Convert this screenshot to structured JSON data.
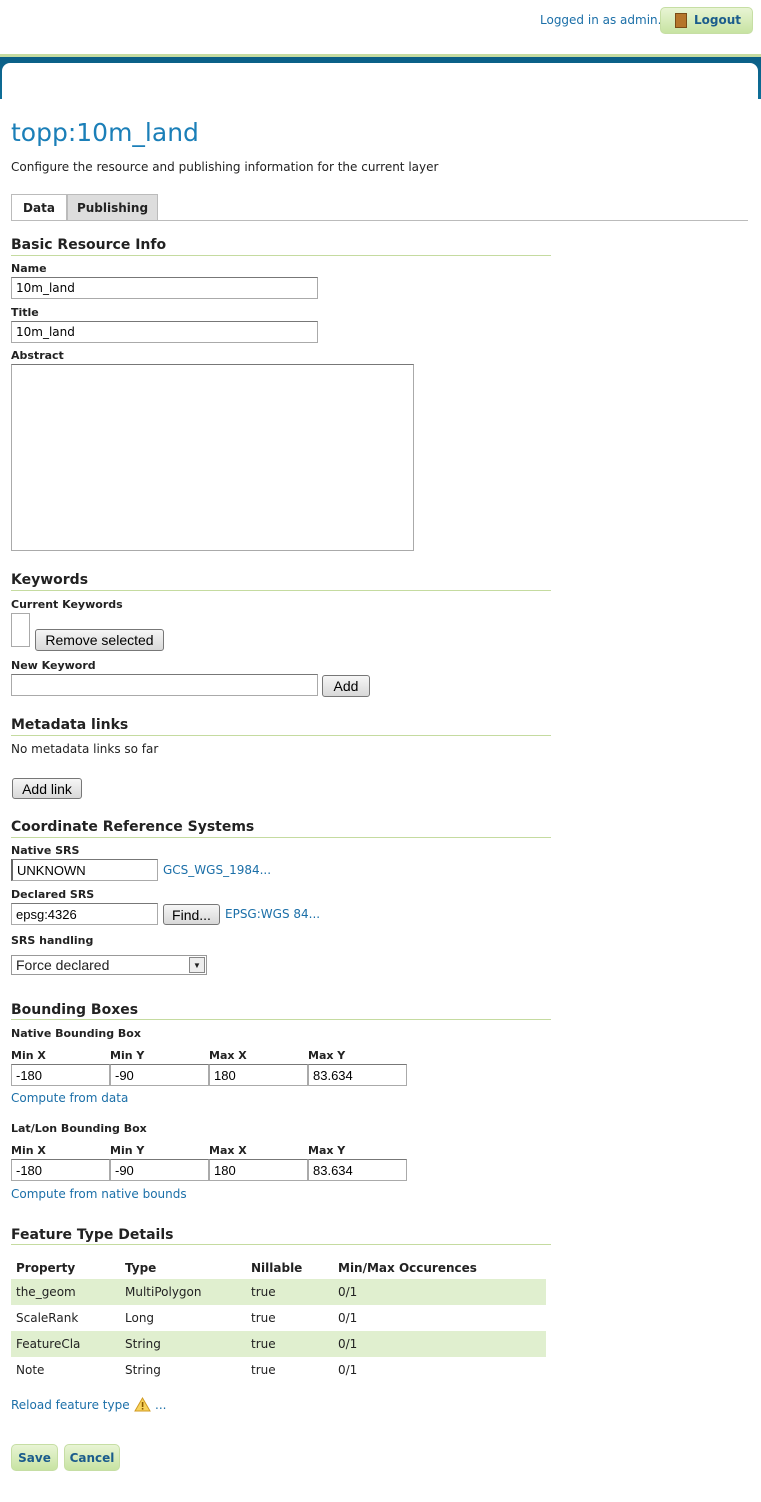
{
  "header": {
    "logged_in": "Logged in as admin.",
    "logout": "Logout"
  },
  "page": {
    "title": "topp:10m_land",
    "subtitle": "Configure the resource and publishing information for the current layer"
  },
  "tabs": [
    {
      "label": "Data",
      "active": true
    },
    {
      "label": "Publishing",
      "active": false
    }
  ],
  "basic": {
    "heading": "Basic Resource Info",
    "name_label": "Name",
    "name_value": "10m_land",
    "title_label": "Title",
    "title_value": "10m_land",
    "abstract_label": "Abstract",
    "abstract_value": ""
  },
  "keywords": {
    "heading": "Keywords",
    "current_label": "Current Keywords",
    "remove_button": "Remove selected",
    "new_label": "New Keyword",
    "new_value": "",
    "add_button": "Add"
  },
  "metadata": {
    "heading": "Metadata links",
    "empty_text": "No metadata links so far",
    "add_button": "Add link"
  },
  "crs": {
    "heading": "Coordinate Reference Systems",
    "native_label": "Native SRS",
    "native_value": "UNKNOWN",
    "native_link": "GCS_WGS_1984...",
    "declared_label": "Declared SRS",
    "declared_value": "epsg:4326",
    "find_button": "Find...",
    "declared_link": "EPSG:WGS 84...",
    "handling_label": "SRS handling",
    "handling_value": "Force declared"
  },
  "bbox": {
    "heading": "Bounding Boxes",
    "native": {
      "label": "Native Bounding Box",
      "cols": [
        "Min X",
        "Min Y",
        "Max X",
        "Max Y"
      ],
      "values": [
        "-180",
        "-90",
        "180",
        "83.634"
      ],
      "link": "Compute from data"
    },
    "latlon": {
      "label": "Lat/Lon Bounding Box",
      "cols": [
        "Min X",
        "Min Y",
        "Max X",
        "Max Y"
      ],
      "values": [
        "-180",
        "-90",
        "180",
        "83.634"
      ],
      "link": "Compute from native bounds"
    }
  },
  "features": {
    "heading": "Feature Type Details",
    "columns": [
      "Property",
      "Type",
      "Nillable",
      "Min/Max Occurences"
    ],
    "rows": [
      [
        "the_geom",
        "MultiPolygon",
        "true",
        "0/1"
      ],
      [
        "ScaleRank",
        "Long",
        "true",
        "0/1"
      ],
      [
        "FeatureCla",
        "String",
        "true",
        "0/1"
      ],
      [
        "Note",
        "String",
        "true",
        "0/1"
      ]
    ],
    "reload_link": "Reload feature type",
    "warning_icon": "warning-icon",
    "ellipsis": "..."
  },
  "actions": {
    "save": "Save",
    "cancel": "Cancel"
  },
  "colors": {
    "accent": "#1b6fa8",
    "band": "#0b5f86",
    "green": "#c5dba0",
    "row_alt": "#e0efcf"
  }
}
